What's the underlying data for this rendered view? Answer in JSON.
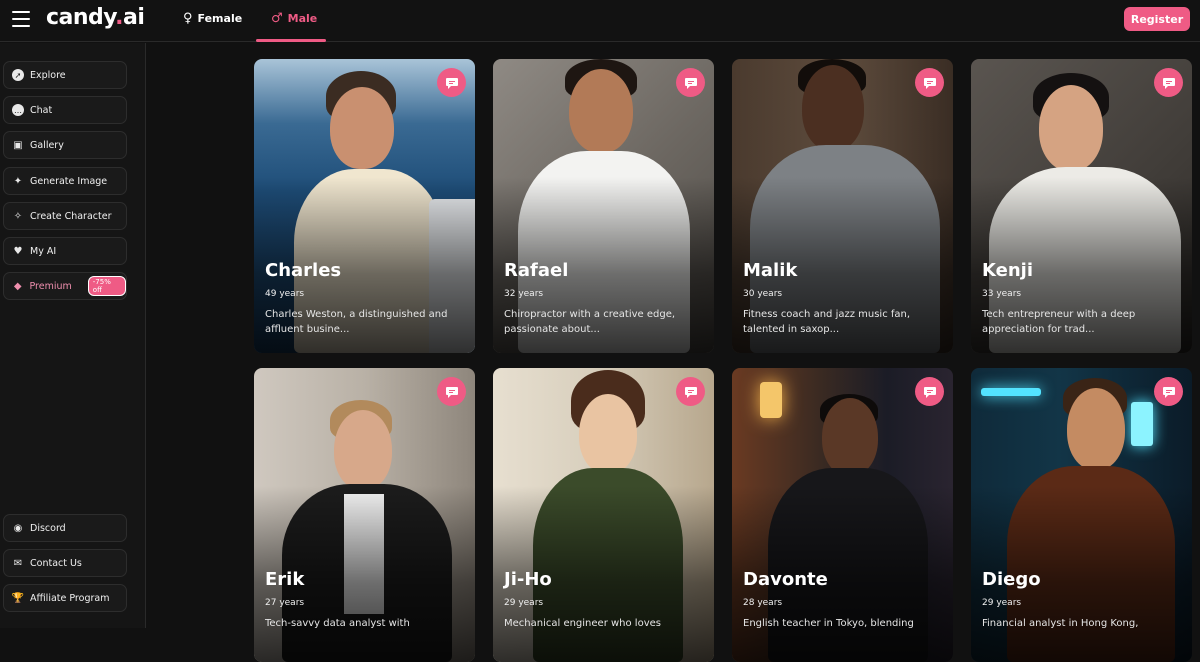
{
  "header": {
    "logo_main": "candy",
    "logo_dot": ".",
    "logo_suffix": "ai",
    "tabs": [
      {
        "label": "Female",
        "icon": "female-icon"
      },
      {
        "label": "Male",
        "icon": "male-icon"
      }
    ],
    "active_tab": "Male",
    "register_label": "Register"
  },
  "sidebar": {
    "items": [
      {
        "label": "Explore",
        "icon": "compass-icon"
      },
      {
        "label": "Chat",
        "icon": "chat-bubble-icon"
      },
      {
        "label": "Gallery",
        "icon": "gallery-icon"
      },
      {
        "label": "Generate Image",
        "icon": "magic-image-icon"
      },
      {
        "label": "Create Character",
        "icon": "magic-wand-icon"
      },
      {
        "label": "My AI",
        "icon": "heart-icon"
      },
      {
        "label": "Premium",
        "icon": "diamond-icon",
        "badge": "-75% off"
      }
    ],
    "footer_items": [
      {
        "label": "Discord",
        "icon": "discord-icon"
      },
      {
        "label": "Contact Us",
        "icon": "mail-icon"
      },
      {
        "label": "Affiliate Program",
        "icon": "trophy-icon"
      }
    ]
  },
  "characters": [
    {
      "name": "Charles",
      "age": "49 years",
      "desc": "Charles Weston, a distinguished and affluent busine..."
    },
    {
      "name": "Rafael",
      "age": "32 years",
      "desc": "Chiropractor with a creative edge, passionate about..."
    },
    {
      "name": "Malik",
      "age": "30 years",
      "desc": "Fitness coach and jazz music fan, talented in saxop..."
    },
    {
      "name": "Kenji",
      "age": "33 years",
      "desc": "Tech entrepreneur with a deep appreciation for trad..."
    },
    {
      "name": "Erik",
      "age": "27 years",
      "desc": "Tech-savvy data analyst with"
    },
    {
      "name": "Ji-Ho",
      "age": "29 years",
      "desc": "Mechanical engineer who loves"
    },
    {
      "name": "Davonte",
      "age": "28 years",
      "desc": "English teacher in Tokyo, blending"
    },
    {
      "name": "Diego",
      "age": "29 years",
      "desc": "Financial analyst in Hong Kong,"
    }
  ],
  "colors": {
    "accent": "#ef5b85",
    "background": "#111111",
    "sidebar": "#151515"
  }
}
